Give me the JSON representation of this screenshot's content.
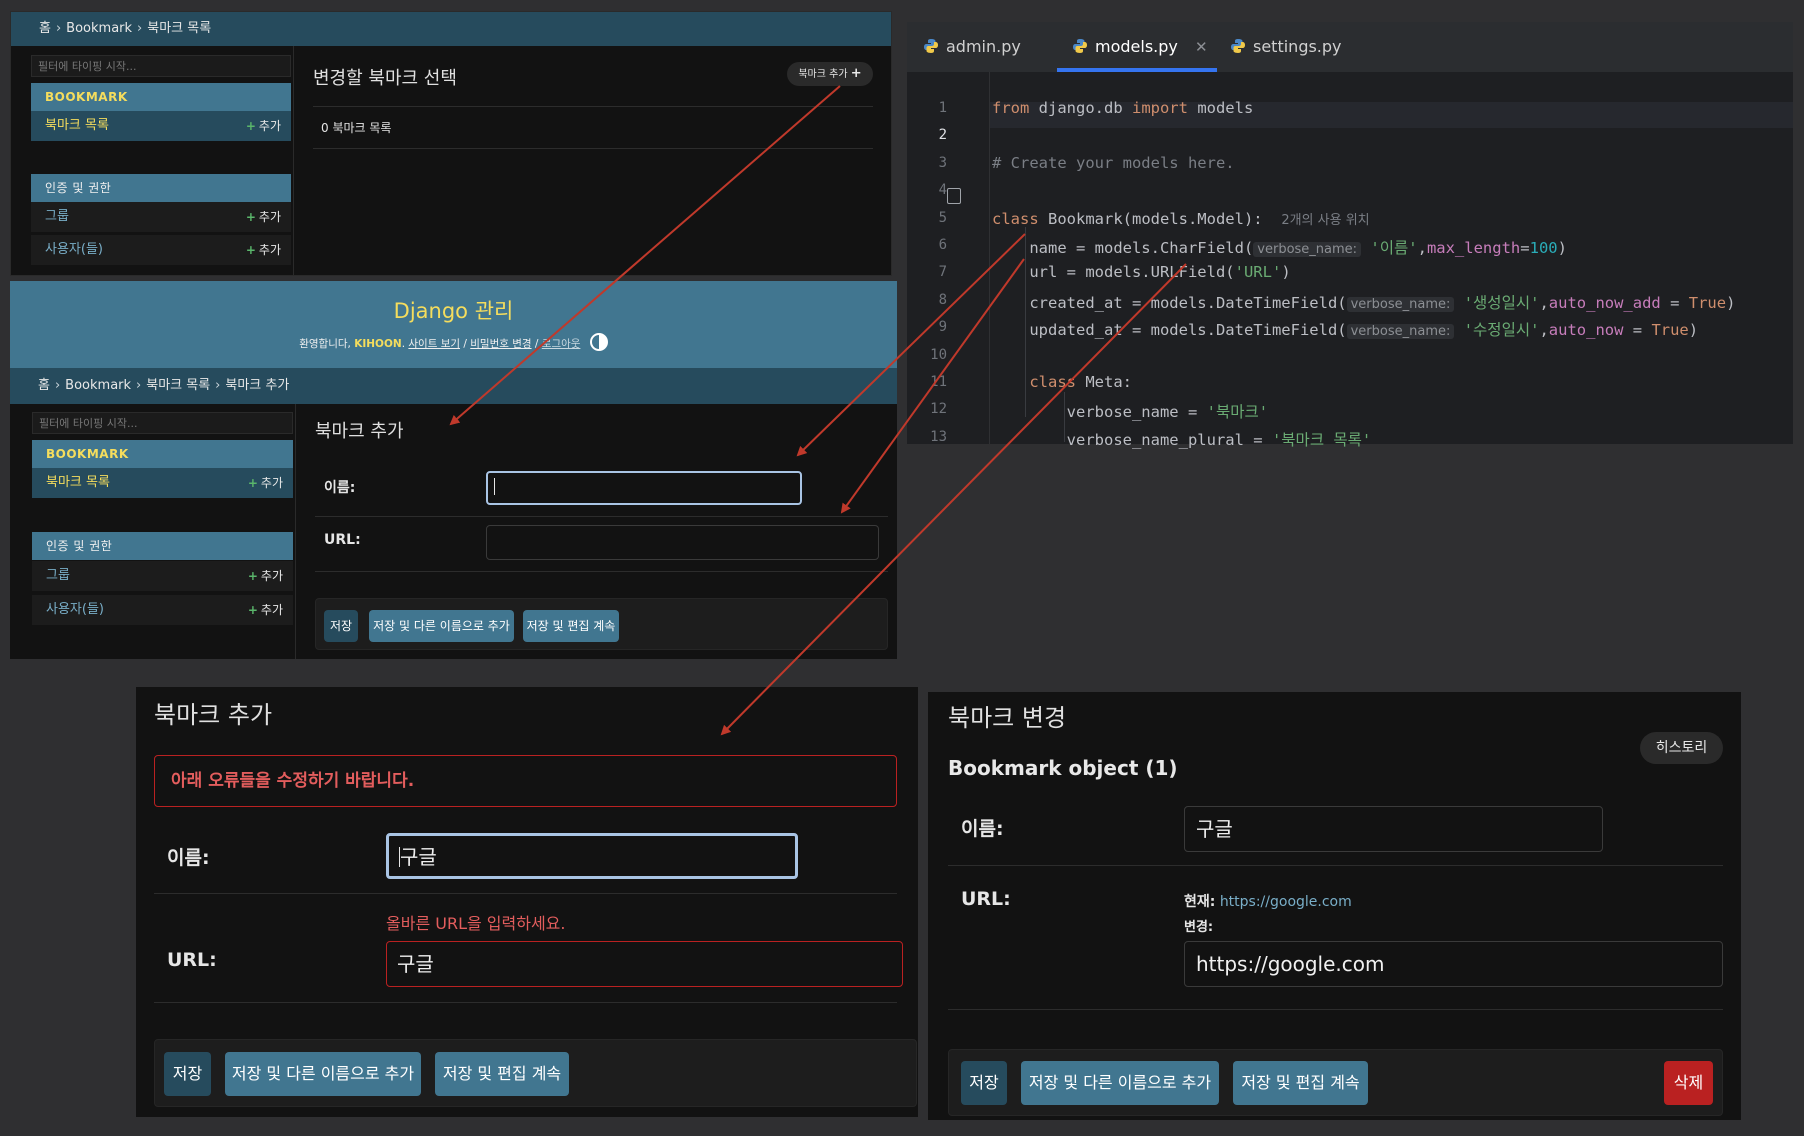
{
  "panel_list": {
    "breadcrumb": [
      "홈",
      "Bookmark",
      "북마크 목록"
    ],
    "filter_placeholder": "필터에 타이핑 시작...",
    "app_bookmark": "BOOKMARK",
    "model_bookmark": "북마크 목록",
    "add_label": "추가",
    "app_auth": "인증 및 권한",
    "model_group": "그룹",
    "model_user": "사용자(들)",
    "title": "변경할 북마크 선택",
    "add_button": "북마크 추가",
    "count_text": "0 북마크 목록"
  },
  "panel_add": {
    "site_title": "Django 관리",
    "welcome_prefix": "환영합니다,",
    "username": "KIHOON",
    "link_view_site": "사이트 보기",
    "link_password": "비밀번호 변경",
    "link_logout": "로그아웃",
    "breadcrumb": [
      "홈",
      "Bookmark",
      "북마크 목록",
      "북마크 추가"
    ],
    "filter_placeholder": "필터에 타이핑 시작...",
    "app_bookmark": "BOOKMARK",
    "model_bookmark": "북마크 목록",
    "add_label": "추가",
    "app_auth": "인증 및 권한",
    "model_group": "그룹",
    "model_user": "사용자(들)",
    "title": "북마크 추가",
    "label_name": "이름:",
    "label_url": "URL:",
    "name_value": "",
    "url_value": "",
    "btn_save": "저장",
    "btn_save_add": "저장 및 다른 이름으로 추가",
    "btn_save_continue": "저장 및 편집 계속"
  },
  "panel_error": {
    "title": "북마크 추가",
    "error_note": "아래 오류들을 수정하기 바랍니다.",
    "label_name": "이름:",
    "name_value": "구글",
    "url_error": "올바른 URL을 입력하세요.",
    "label_url": "URL:",
    "url_value": "구글",
    "btn_save": "저장",
    "btn_save_add": "저장 및 다른 이름으로 추가",
    "btn_save_continue": "저장 및 편집 계속"
  },
  "panel_change": {
    "title": "북마크 변경",
    "history_button": "히스토리",
    "object_title": "Bookmark object (1)",
    "label_name": "이름:",
    "name_value": "구글",
    "label_url": "URL:",
    "current_label": "현재:",
    "current_url": "https://google.com",
    "change_label": "변경:",
    "url_value": "https://google.com",
    "btn_save": "저장",
    "btn_save_add": "저장 및 다른 이름으로 추가",
    "btn_save_continue": "저장 및 편집 계속",
    "btn_delete": "삭제"
  },
  "editor": {
    "tabs": [
      "admin.py",
      "models.py",
      "settings.py"
    ],
    "active_tab": "models.py",
    "lines": [
      {
        "n": "1",
        "parts": [
          [
            "kw",
            "from"
          ],
          [
            "",
            " django.db "
          ],
          [
            "kw",
            "import"
          ],
          [
            "",
            " models"
          ]
        ]
      },
      {
        "n": "2",
        "parts": []
      },
      {
        "n": "3",
        "parts": [
          [
            "cm",
            "# Create your models here."
          ]
        ]
      },
      {
        "n": "4",
        "parts": []
      },
      {
        "n": "5",
        "parts": [
          [
            "kw",
            "class"
          ],
          [
            "",
            " Bookmark(models.Model):  "
          ],
          [
            "usage",
            "2개의 사용 위치"
          ]
        ]
      },
      {
        "n": "6",
        "parts": [
          [
            "",
            "    name = models.CharField("
          ],
          [
            "hint",
            "verbose_name:"
          ],
          [
            "",
            " "
          ],
          [
            "str",
            "'이름'"
          ],
          [
            "",
            ","
          ],
          [
            "prm",
            "max_length"
          ],
          [
            "",
            "="
          ],
          [
            "num",
            "100"
          ],
          [
            "",
            ")"
          ]
        ]
      },
      {
        "n": "7",
        "parts": [
          [
            "",
            "    url = models.URLField("
          ],
          [
            "str",
            "'URL'"
          ],
          [
            "",
            ")"
          ]
        ]
      },
      {
        "n": "8",
        "parts": [
          [
            "",
            "    created_at = models.DateTimeField("
          ],
          [
            "hint",
            "verbose_name:"
          ],
          [
            "",
            " "
          ],
          [
            "str",
            "'생성일시'"
          ],
          [
            "",
            ","
          ],
          [
            "prm",
            "auto_now_add"
          ],
          [
            "",
            " = "
          ],
          [
            "kw",
            "True"
          ],
          [
            "",
            ")"
          ]
        ]
      },
      {
        "n": "9",
        "parts": [
          [
            "",
            "    updated_at = models.DateTimeField("
          ],
          [
            "hint",
            "verbose_name:"
          ],
          [
            "",
            " "
          ],
          [
            "str",
            "'수정일시'"
          ],
          [
            "",
            ","
          ],
          [
            "prm",
            "auto_now"
          ],
          [
            "",
            " = "
          ],
          [
            "kw",
            "True"
          ],
          [
            "",
            ")"
          ]
        ]
      },
      {
        "n": "10",
        "parts": []
      },
      {
        "n": "11",
        "parts": [
          [
            "",
            "    "
          ],
          [
            "kw",
            "class"
          ],
          [
            "",
            " Meta:"
          ]
        ]
      },
      {
        "n": "12",
        "parts": [
          [
            "",
            "        verbose_name = "
          ],
          [
            "str",
            "'북마크'"
          ]
        ]
      },
      {
        "n": "13",
        "parts": [
          [
            "",
            "        verbose_name_plural = "
          ],
          [
            "str",
            "'북마크 목록'"
          ]
        ]
      }
    ]
  },
  "colors": {
    "annotation_arrow": "#c0392b",
    "header_bg": "#417690",
    "breadcrumb_bg": "#264b5d",
    "accent_yellow": "#f5dd5d",
    "error_red": "#ba2121"
  },
  "icons": [
    "plus-icon",
    "theme-toggle-icon",
    "python-file-icon",
    "close-icon",
    "gutter-class-icon"
  ]
}
